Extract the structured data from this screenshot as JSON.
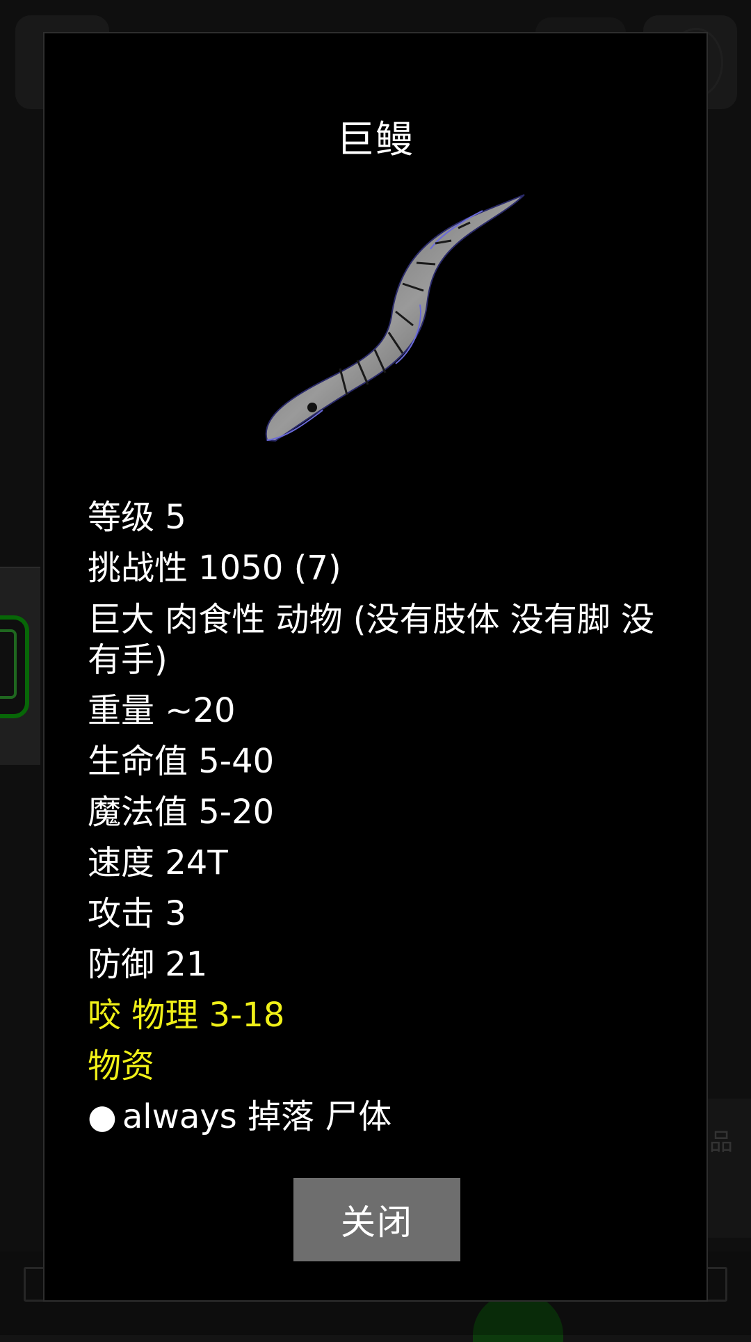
{
  "dialog": {
    "title": "巨鳗",
    "creature_icon": "giant-eel-sprite",
    "stats": {
      "level": "等级 5",
      "challenge": "挑战性 1050 (7)",
      "traits": "巨大 肉食性 动物 (没有肢体 没有脚 没有手)",
      "weight": "重量 ~20",
      "hp": "生命值 5-40",
      "mp": "魔法值 5-20",
      "speed": "速度 24T",
      "attack": "攻击 3",
      "defense": "防御 21",
      "bite": "咬 物理 3-18",
      "loot_header": "物资",
      "loot_bullet": "●",
      "loot_item": "always 掉落 尸体"
    },
    "close_label": "关闭"
  },
  "background": {
    "right_panel_text": "品"
  },
  "colors": {
    "dialog_bg": "#000000",
    "text": "#ffffff",
    "highlight": "#f0f018",
    "button_bg": "#6e6e6e"
  }
}
